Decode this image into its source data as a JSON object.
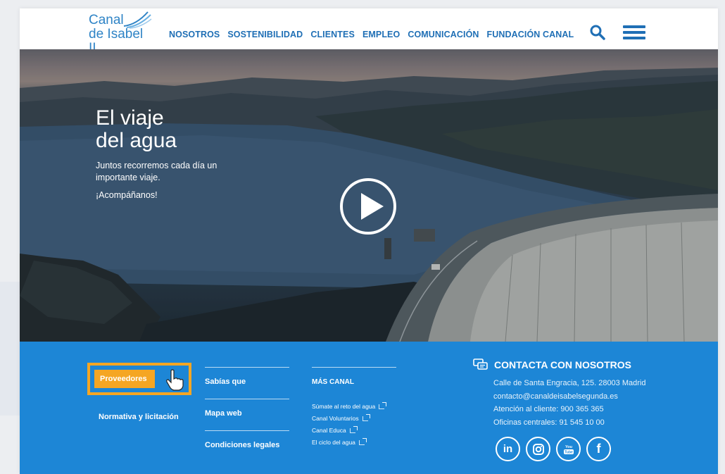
{
  "header": {
    "logo_line1": "Canal",
    "logo_line2": "de Isabel II",
    "nav": [
      "NOSOTROS",
      "SOSTENIBILIDAD",
      "CLIENTES",
      "EMPLEO",
      "COMUNICACIÓN",
      "FUNDACIÓN CANAL"
    ]
  },
  "hero": {
    "title_line1": "El viaje",
    "title_line2": "del agua",
    "subtitle": "Juntos recorremos cada día un importante viaje.",
    "cta": "¡Acompáñanos!"
  },
  "footer": {
    "col1": [
      "Proveedores",
      "Normativa y licitación"
    ],
    "col2": [
      "Sabías que",
      "Mapa web",
      "Condiciones legales"
    ],
    "col3_title": "MÁS CANAL",
    "col3_links": [
      "Súmate al reto del agua",
      "Canal Voluntarios",
      "Canal Educa",
      "El ciclo del agua"
    ],
    "contact_title": "CONTACTA CON NOSOTROS",
    "contact_lines": [
      "Calle de Santa Engracia, 125. 28003 Madrid",
      "contacto@canaldeisabelsegunda.es",
      "Atención al cliente: 900 365 365",
      "Oficinas centrales: 91 545 10 00"
    ],
    "socials": [
      "in",
      "ig",
      "You Tube",
      "f"
    ]
  },
  "colors": {
    "brand_blue": "#1f6fb5",
    "footer_blue": "#1d86d6",
    "highlight_orange": "#f5a623"
  }
}
